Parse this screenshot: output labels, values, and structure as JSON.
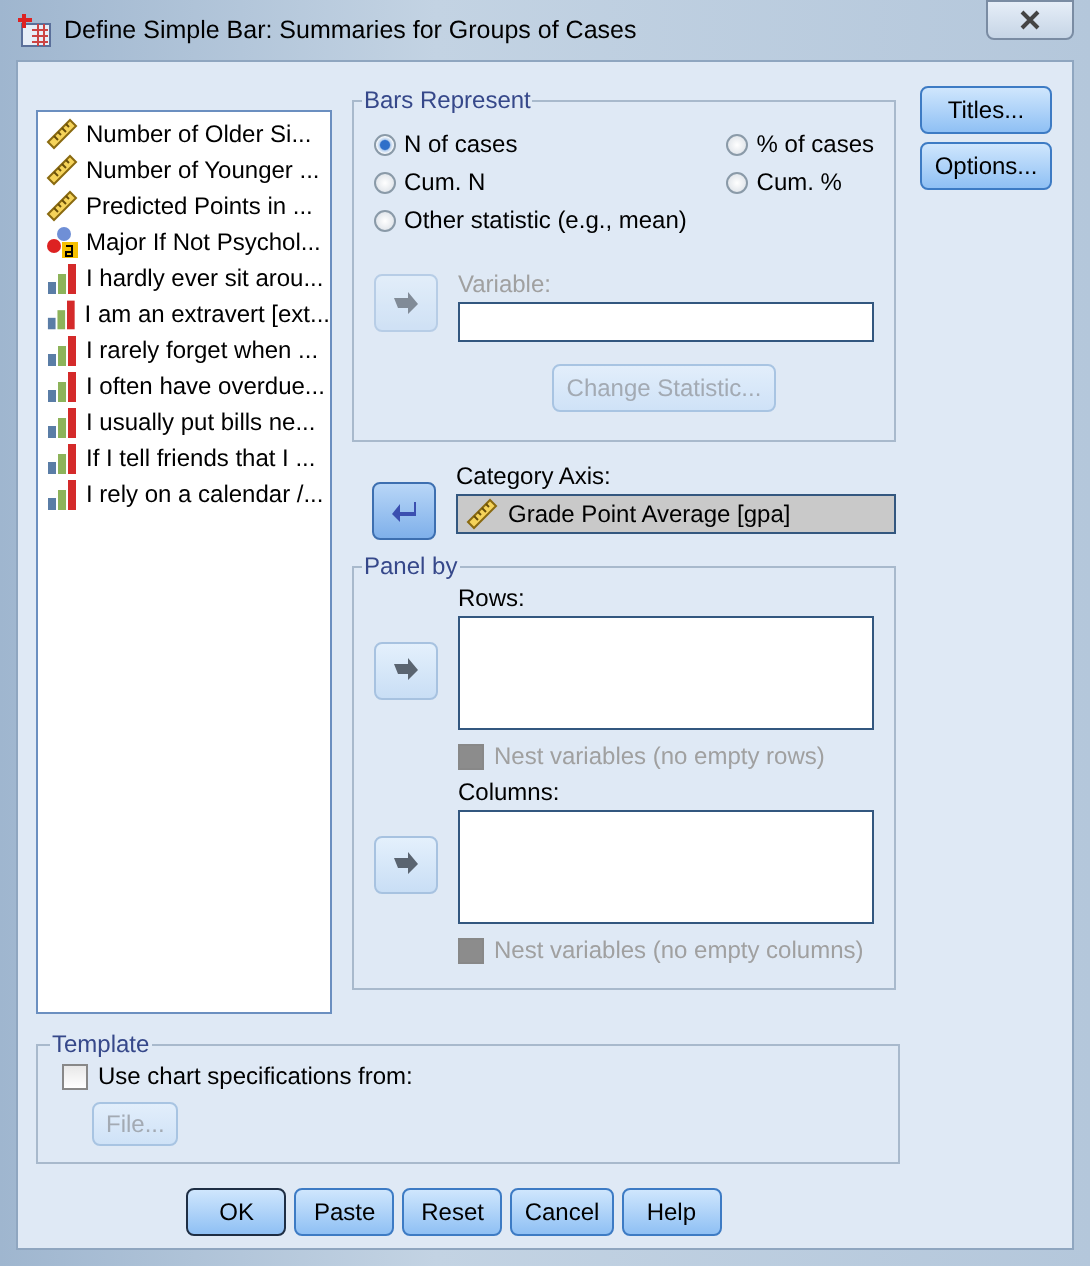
{
  "window": {
    "title": "Define Simple Bar: Summaries for Groups of Cases"
  },
  "variables": [
    {
      "label": "Number of Older Si...",
      "kind": "scale"
    },
    {
      "label": "Number of Younger ...",
      "kind": "scale"
    },
    {
      "label": "Predicted Points in ...",
      "kind": "scale"
    },
    {
      "label": "Major If Not Psychol...",
      "kind": "nominal"
    },
    {
      "label": "I hardly ever sit arou...",
      "kind": "ordinal"
    },
    {
      "label": "I am an extravert [ext...",
      "kind": "ordinal"
    },
    {
      "label": "I rarely forget when ...",
      "kind": "ordinal"
    },
    {
      "label": "I often have overdue...",
      "kind": "ordinal"
    },
    {
      "label": "I usually put bills ne...",
      "kind": "ordinal"
    },
    {
      "label": "If I tell friends that I ...",
      "kind": "ordinal"
    },
    {
      "label": "I rely on a calendar /...",
      "kind": "ordinal"
    }
  ],
  "bars_represent": {
    "title": "Bars Represent",
    "options": [
      {
        "label": "N of cases",
        "selected": true
      },
      {
        "label": "% of cases",
        "selected": false
      },
      {
        "label": "Cum. N",
        "selected": false
      },
      {
        "label": "Cum. %",
        "selected": false
      },
      {
        "label": "Other statistic (e.g., mean)",
        "selected": false
      }
    ],
    "variable": {
      "label": "Variable:",
      "disabled": true
    },
    "change_statistic": {
      "label": "Change Statistic...",
      "disabled": true
    }
  },
  "category_axis": {
    "label": "Category Axis:",
    "disabled": false,
    "value": "Grade Point Average [gpa]",
    "kind": "scale"
  },
  "panel_by": {
    "title": "Panel by",
    "targets": [
      {
        "label": "Rows:",
        "disabled": false,
        "nest": {
          "label": "Nest variables (no empty rows)",
          "checked": false,
          "disabled": true
        }
      },
      {
        "label": "Columns:",
        "disabled": false,
        "nest": {
          "label": "Nest variables (no empty columns)",
          "checked": false,
          "disabled": true
        }
      }
    ]
  },
  "side_buttons": [
    "Titles...",
    "Options..."
  ],
  "template": {
    "title": "Template",
    "checkbox": {
      "label": "Use chart specifications from:",
      "checked": false,
      "disabled": false
    },
    "file_button": {
      "label": "File...",
      "disabled": true
    }
  },
  "buttons": [
    {
      "label": "OK",
      "default": true
    },
    {
      "label": "Paste",
      "default": false
    },
    {
      "label": "Reset",
      "default": false
    },
    {
      "label": "Cancel",
      "default": false
    },
    {
      "label": "Help",
      "default": false
    }
  ]
}
